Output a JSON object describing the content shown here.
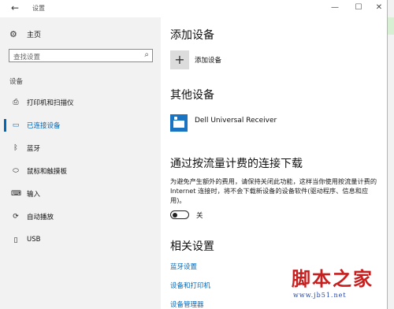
{
  "window": {
    "title": "设置",
    "back_icon": "←",
    "min_icon": "—",
    "max_icon": "☐",
    "close_icon": "✕"
  },
  "sidebar": {
    "home_icon": "⚙",
    "home_label": "主页",
    "search_placeholder": "查找设置",
    "search_icon": "⌕",
    "section_label": "设备",
    "items": [
      {
        "label": "打印机和扫描仪",
        "icon": "⎙",
        "icon_name": "printer-icon",
        "selected": false
      },
      {
        "label": "已连接设备",
        "icon": "▭",
        "icon_name": "connected-devices-icon",
        "selected": true
      },
      {
        "label": "蓝牙",
        "icon": "ᛒ",
        "icon_name": "bluetooth-icon",
        "selected": false
      },
      {
        "label": "鼠标和触摸板",
        "icon": "⬭",
        "icon_name": "mouse-icon",
        "selected": false
      },
      {
        "label": "输入",
        "icon": "⌨",
        "icon_name": "keyboard-icon",
        "selected": false
      },
      {
        "label": "自动播放",
        "icon": "⟳",
        "icon_name": "autoplay-icon",
        "selected": false
      },
      {
        "label": "USB",
        "icon": "▯",
        "icon_name": "usb-icon",
        "selected": false
      }
    ]
  },
  "main": {
    "add_heading": "添加设备",
    "add_icon": "+",
    "add_label": "添加设备",
    "other_heading": "其他设备",
    "device_name": "Dell Universal Receiver",
    "metered_heading": "通过按流量计费的连接下载",
    "metered_desc": "为避免产生额外的费用，请保持关闭此功能，这样当你使用按流量计费的 Internet 连接时，将不会下载新设备的设备软件(驱动程序、信息和应用)。",
    "toggle_state": "关",
    "related_heading": "相关设置",
    "links": [
      "蓝牙设置",
      "设备和打印机",
      "设备管理器"
    ]
  },
  "watermark": {
    "brand": "脚本之家",
    "url": "www.jb51.net"
  },
  "colors": {
    "accent": "#0067b8",
    "sidebar_bg": "#f2f2f2",
    "watermark_red": "#c81e1e",
    "watermark_blue": "#1e3fa8"
  }
}
